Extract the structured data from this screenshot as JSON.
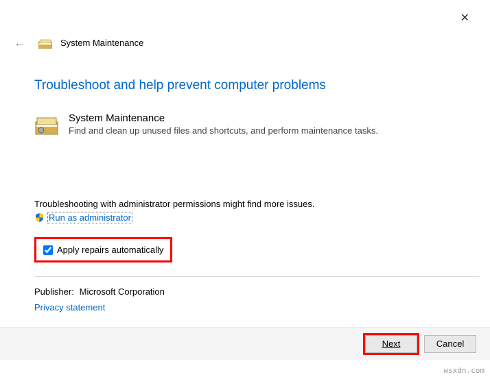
{
  "header": {
    "title": "System Maintenance"
  },
  "main": {
    "heading": "Troubleshoot and help prevent computer problems",
    "section_title": "System Maintenance",
    "section_desc": "Find and clean up unused files and shortcuts, and perform maintenance tasks.",
    "admin_note": "Troubleshooting with administrator permissions might find more issues.",
    "admin_link": "Run as administrator",
    "apply_repairs_label": "Apply repairs automatically",
    "publisher_label": "Publisher:",
    "publisher_value": "Microsoft Corporation",
    "privacy_link": "Privacy statement"
  },
  "footer": {
    "next": "Next",
    "cancel": "Cancel"
  },
  "watermark": "wsxdn.com"
}
